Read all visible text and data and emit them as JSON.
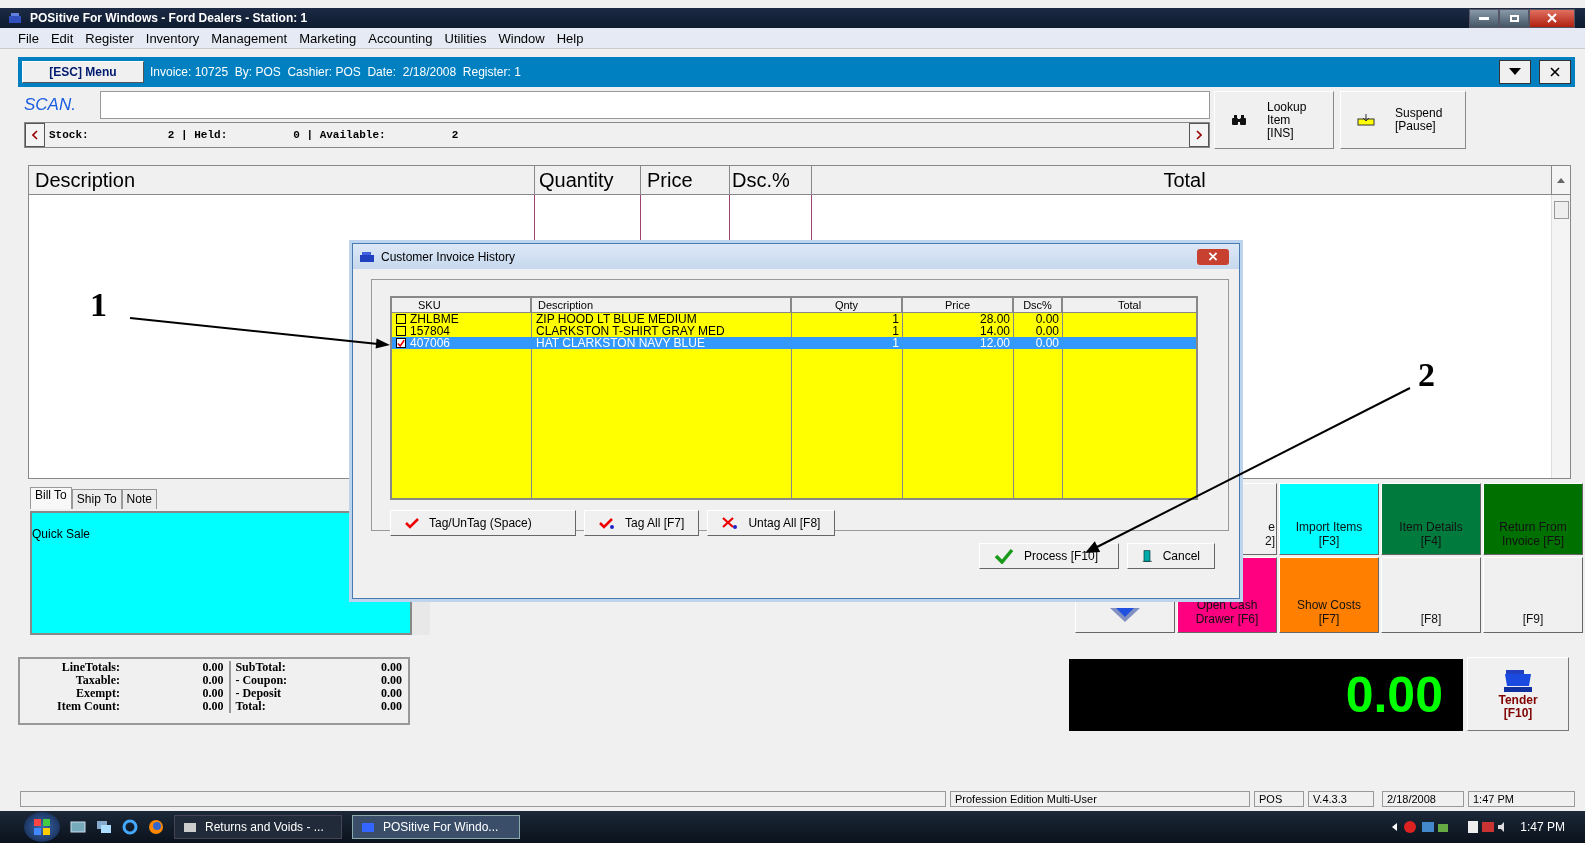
{
  "window": {
    "title": "POSitive For Windows - Ford Dealers - Station: 1"
  },
  "menu": [
    "File",
    "Edit",
    "Register",
    "Inventory",
    "Management",
    "Marketing",
    "Accounting",
    "Utilities",
    "Window",
    "Help"
  ],
  "toolbar": {
    "menu_button": "[ESC] Menu",
    "invoice_info": "Invoice: 10725  By: POS  Cashier: POS  Date:  2/18/2008  Register: 1"
  },
  "scan": {
    "label": "SCAN.",
    "stock_info": "Stock:            2 | Held:          0 | Available:          2"
  },
  "actions": [
    {
      "kind": "lookup",
      "lines": [
        "Lookup",
        "Item",
        "[INS]"
      ]
    },
    {
      "kind": "suspend",
      "lines": [
        "Suspend",
        "[Pause]"
      ]
    }
  ],
  "line_table": {
    "columns": [
      "Description",
      "Quantity",
      "Price",
      "Dsc.%",
      "Total"
    ]
  },
  "customer_tabs": [
    {
      "label": "Bill To",
      "selected": true
    },
    {
      "label": "Ship To",
      "selected": false
    },
    {
      "label": "Note",
      "selected": false
    }
  ],
  "bill_to": {
    "text": "Quick Sale"
  },
  "function_keys": [
    {
      "kind": "partial",
      "lines": [
        "e",
        "2]"
      ],
      "color": "#f0f0f0"
    },
    {
      "kind": "text",
      "lines": [
        "Import Items",
        "[F3]"
      ],
      "color": "#00ffff"
    },
    {
      "kind": "text",
      "lines": [
        "Item Details",
        "[F4]"
      ],
      "color": "#007a3d"
    },
    {
      "kind": "text",
      "lines": [
        "Return From",
        "Invoice [F5]"
      ],
      "color": "#007000"
    },
    {
      "kind": "icon",
      "color": "#f0f0f0"
    },
    {
      "kind": "text",
      "lines": [
        "Open Cash",
        "Drawer [F6]"
      ],
      "color": "#ff0080"
    },
    {
      "kind": "text",
      "lines": [
        "Show Costs",
        "[F7]"
      ],
      "color": "#ff8000"
    },
    {
      "kind": "text",
      "lines": [
        "[F8]"
      ],
      "color": "#f0f0f0"
    },
    {
      "kind": "text",
      "lines": [
        "[F9]"
      ],
      "color": "#f0f0f0"
    }
  ],
  "totals_left": [
    {
      "label": "LineTotals:",
      "value": "0.00"
    },
    {
      "label": "Taxable:",
      "value": "0.00"
    },
    {
      "label": "Exempt:",
      "value": "0.00"
    },
    {
      "label": "Item Count:",
      "value": "0.00"
    }
  ],
  "totals_right": [
    {
      "label": "SubTotal:",
      "value": "0.00"
    },
    {
      "label": "- Coupon:",
      "value": "0.00"
    },
    {
      "label": "- Deposit",
      "value": "0.00"
    },
    {
      "label": "Total:",
      "value": "0.00"
    }
  ],
  "display": {
    "amount": "0.00"
  },
  "tender": {
    "lines": [
      "Tender",
      "[F10]"
    ]
  },
  "status_bar": [
    "Profession Edition Multi-User",
    "POS",
    "V.4.3.3",
    "2/18/2008",
    "1:47 PM"
  ],
  "taskbar": {
    "items": [
      {
        "label": "Returns and Voids - ...",
        "selected": false
      },
      {
        "label": "POSitive For Windo...",
        "selected": true
      }
    ],
    "clock": "1:47 PM"
  },
  "dialog": {
    "title": "Customer Invoice History",
    "columns": [
      "SKU",
      "Description",
      "Qnty",
      "Price",
      "Dsc%",
      "Total"
    ],
    "rows": [
      {
        "sku": "ZHLBME",
        "description": "ZIP HOOD LT BLUE MEDIUM",
        "qnty": "1",
        "price": "28.00",
        "dsc": "0.00",
        "checked": false,
        "selected": false
      },
      {
        "sku": "157804",
        "description": "CLARKSTON T-SHIRT GRAY MED",
        "qnty": "1",
        "price": "14.00",
        "dsc": "0.00",
        "checked": false,
        "selected": false
      },
      {
        "sku": "407006",
        "description": "HAT CLARKSTON NAVY BLUE",
        "qnty": "1",
        "price": "12.00",
        "dsc": "0.00",
        "checked": true,
        "selected": true
      }
    ],
    "tag_buttons": [
      {
        "kind": "tag",
        "label": "Tag/UnTag (Space)"
      },
      {
        "kind": "tag_all",
        "label": "Tag All [F7]"
      },
      {
        "kind": "untag_all",
        "label": "Untag All [F8]"
      }
    ],
    "footer_buttons": [
      {
        "kind": "process",
        "label": "Process [F10]"
      },
      {
        "kind": "cancel",
        "label": "Cancel"
      }
    ]
  },
  "annotations": [
    {
      "label": "1"
    },
    {
      "label": "2"
    }
  ]
}
